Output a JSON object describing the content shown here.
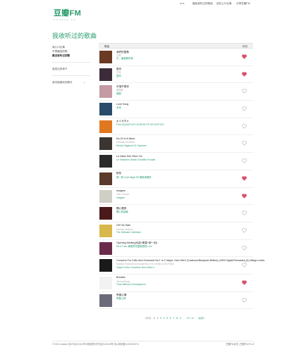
{
  "topbar": {
    "user": "xx",
    "user_caret": "▾",
    "links": [
      "播放我听过的歌曲",
      "回忆心口往事",
      "分享豆瓣FM"
    ]
  },
  "logo": {
    "mark": "豆瓣FM",
    "tagline": "DOUBAN.FM"
  },
  "page_title": "我收听过的歌曲",
  "sidebar": {
    "items": [
      {
        "label": "我心口往事",
        "active": false
      },
      {
        "label": "不再播放的歌",
        "active": false
      },
      {
        "label": "最近收听过的歌",
        "active": true
      }
    ],
    "sections": [
      {
        "label": "我发出的单子"
      },
      {
        "label": "我可能喜欢的歌手",
        "chevron": "⌄"
      }
    ]
  },
  "table": {
    "col_song": "歌曲",
    "col_fav": "状况",
    "rows": [
      {
        "title": "我們的愛歌",
        "artist": "王菲",
        "album": "鳥，最重要的事",
        "liked": true,
        "color": "#6b3a24"
      },
      {
        "title": "愛你",
        "artist": "王菲",
        "album": "愛你",
        "liked": true,
        "color": "#3c2c3a"
      },
      {
        "title": "可惜不是你",
        "artist": "梁靜茹",
        "album": "美麗",
        "liked": false,
        "color": "#c49aa4"
      },
      {
        "title": "Love Song",
        "artist": "",
        "album": "未來",
        "liked": false,
        "color": "#2a4c6a"
      },
      {
        "title": "キミガタメ",
        "artist": "",
        "album": "Pure AQUAPLUS LEGEND OF ACOUSTICS",
        "liked": false,
        "color": "#e07820"
      },
      {
        "title": "No.24 In A Minor",
        "artist": "Salvatore Accardo",
        "album": "Nicolo Paganini 24 Caprices",
        "liked": false,
        "color": "#3a3530"
      },
      {
        "title": "La Valse Des Vieux Os",
        "artist": "",
        "album": "Le Fabuleux Destin d'Amélie Poulain",
        "liked": false,
        "color": "#2a2a2a"
      },
      {
        "title": "那些",
        "artist": "",
        "album": "那一夜 Cold Night 99 傳奇演唱會",
        "liked": true,
        "color": "#5a3a2a"
      },
      {
        "title": "Imagine",
        "artist": "John Lennon",
        "album": "Imagine",
        "liked": true,
        "color": "#cfcfc6"
      },
      {
        "title": "開心唱秀",
        "artist": "",
        "album": "開心的過客",
        "liked": false,
        "color": "#4a1a1a"
      },
      {
        "title": "Off The Wall",
        "artist": "Michael Jackson",
        "album": "The Ultimate Collection",
        "liked": false,
        "color": "#d8b84a"
      },
      {
        "title": "Opening Medley(序曲+黃昏+那一刻)",
        "artist": "",
        "album": "Hit & Club 演唱會完整版實錄 Live",
        "liked": false,
        "color": "#6a2a4a"
      },
      {
        "title": "Concerto For Cello And Orchestra No.1 In C Major, Hob.VIIb/1 (Cadenza:Benjamin Britten) (1999 Digital Remaster) (II) Allegro molto",
        "artist": "Mstislav Rostropovich/Academy of St. Martin-in-the-Fields",
        "album": "Haydn Cello Concertos Nos.1&No.2",
        "liked": false,
        "color": "#1a1a1a"
      },
      {
        "title": "Breathe",
        "artist": "Jimmy Brings",
        "album": "Time Without Consequence",
        "liked": true,
        "color": "#f2f2f2"
      },
      {
        "title": "青春心情",
        "artist": "",
        "album": "青春心情",
        "liked": false,
        "color": "#6a6a7a"
      }
    ]
  },
  "pager": {
    "prev": "<前页",
    "pages": [
      "1",
      "2",
      "3",
      "4",
      "5",
      "6",
      "7",
      "8",
      "9",
      "...",
      "10",
      "11"
    ],
    "current": "1",
    "next": "后页>"
  },
  "footer": {
    "copyright": "© 2012 douban 京ICP证110120号 网络视听许可证0110418号 京公网安备11010502274",
    "links": [
      "豆瓣FM反馈",
      "豆瓣FM Pro",
      "2"
    ]
  },
  "colors": {
    "accent": "#2a9c6d",
    "heart_on": "#d9506a",
    "heart_off": "#bbbbbb"
  }
}
